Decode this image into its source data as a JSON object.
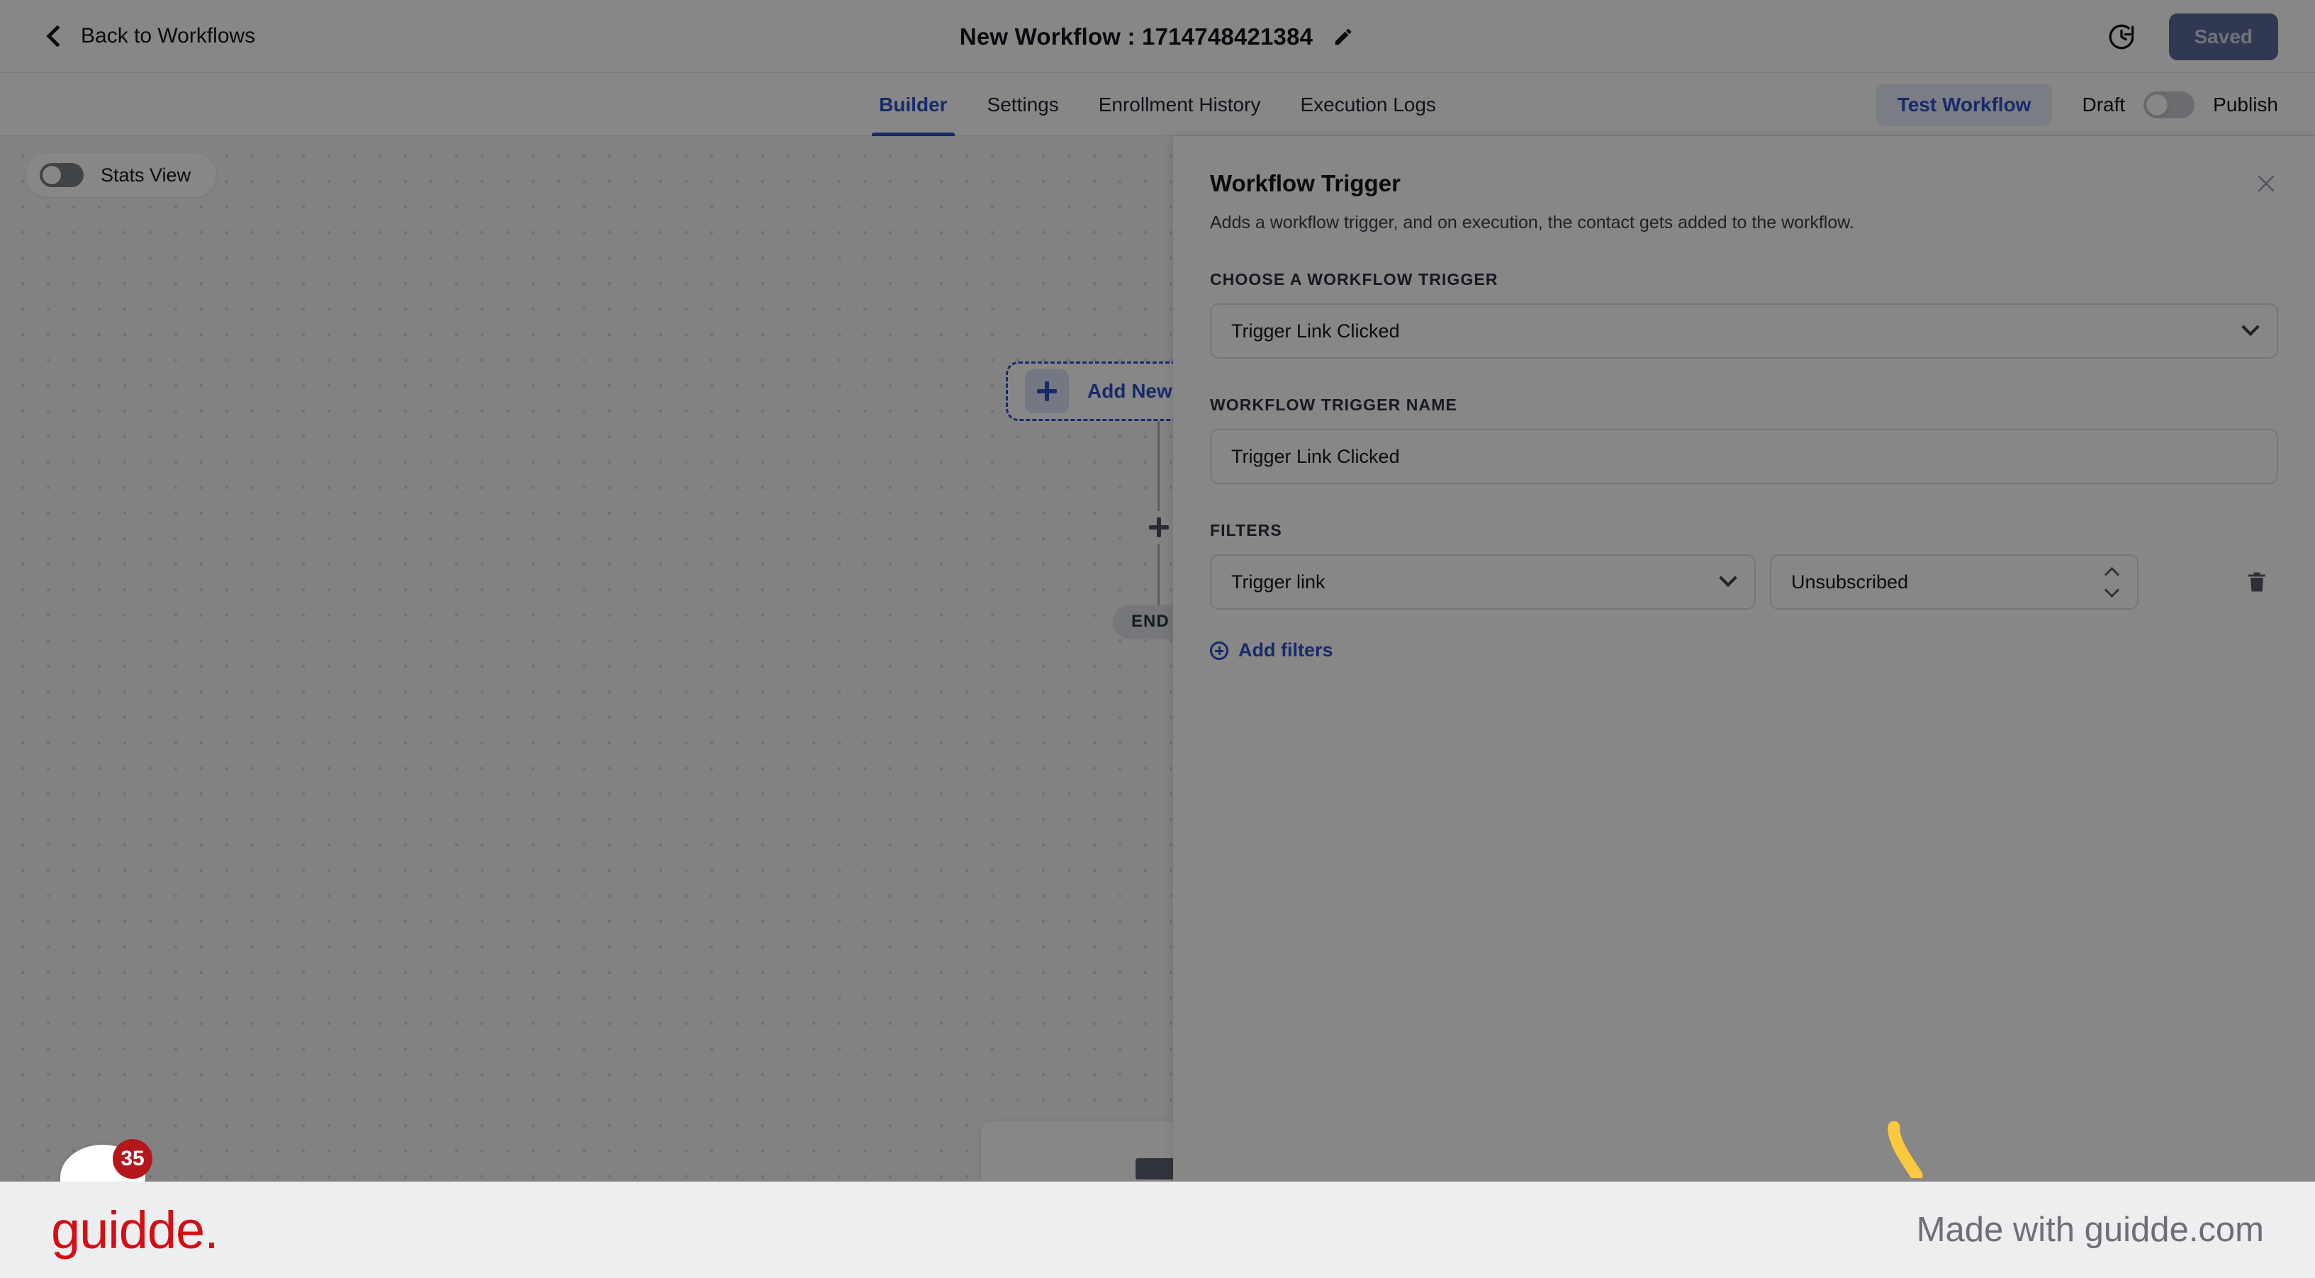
{
  "header": {
    "back_label": "Back to Workflows",
    "back_icon": "chevron-left-icon",
    "title": "New Workflow : 1714748421384",
    "edit_icon": "pencil-icon",
    "history_icon": "clock-history-icon",
    "saved_label": "Saved"
  },
  "tabbar": {
    "tabs": [
      {
        "label": "Builder",
        "active": true
      },
      {
        "label": "Settings",
        "active": false
      },
      {
        "label": "Enrollment History",
        "active": false
      },
      {
        "label": "Execution Logs",
        "active": false
      }
    ],
    "test_workflow_label": "Test Workflow",
    "draft_label": "Draft",
    "publish_label": "Publish",
    "publish_toggle_state": "off"
  },
  "canvas": {
    "stats_view_label": "Stats View",
    "stats_view_toggle_state": "off",
    "trigger_node_label": "Add New Trigger",
    "trigger_node_icon": "plus-icon",
    "connector_plus_icon": "plus-icon",
    "end_label": "END",
    "notification_count": "35"
  },
  "panel": {
    "title": "Workflow Trigger",
    "subtitle": "Adds a workflow trigger, and on execution, the contact gets added to the workflow.",
    "close_icon": "close-icon",
    "choose_trigger_label": "CHOOSE A WORKFLOW TRIGGER",
    "choose_trigger_value": "Trigger Link Clicked",
    "trigger_name_label": "WORKFLOW TRIGGER NAME",
    "trigger_name_value": "Trigger Link Clicked",
    "filters_label": "FILTERS",
    "filter_field_value": "Trigger link",
    "filter_value_value": "Unsubscribed",
    "delete_icon": "trash-icon",
    "add_filters_label": "Add filters",
    "add_filters_icon": "circle-plus-icon"
  },
  "banner": {
    "logo_text": "guidde.",
    "made_with_text": "Made with guidde.com"
  },
  "colors": {
    "accent_blue": "#2c50c7",
    "saved_button_bg": "#5c6b9e",
    "brand_red": "#d40f14",
    "badge_red": "#b3171b",
    "annotation_yellow": "#fbc93d",
    "canvas_bg": "#f5f6f8"
  }
}
